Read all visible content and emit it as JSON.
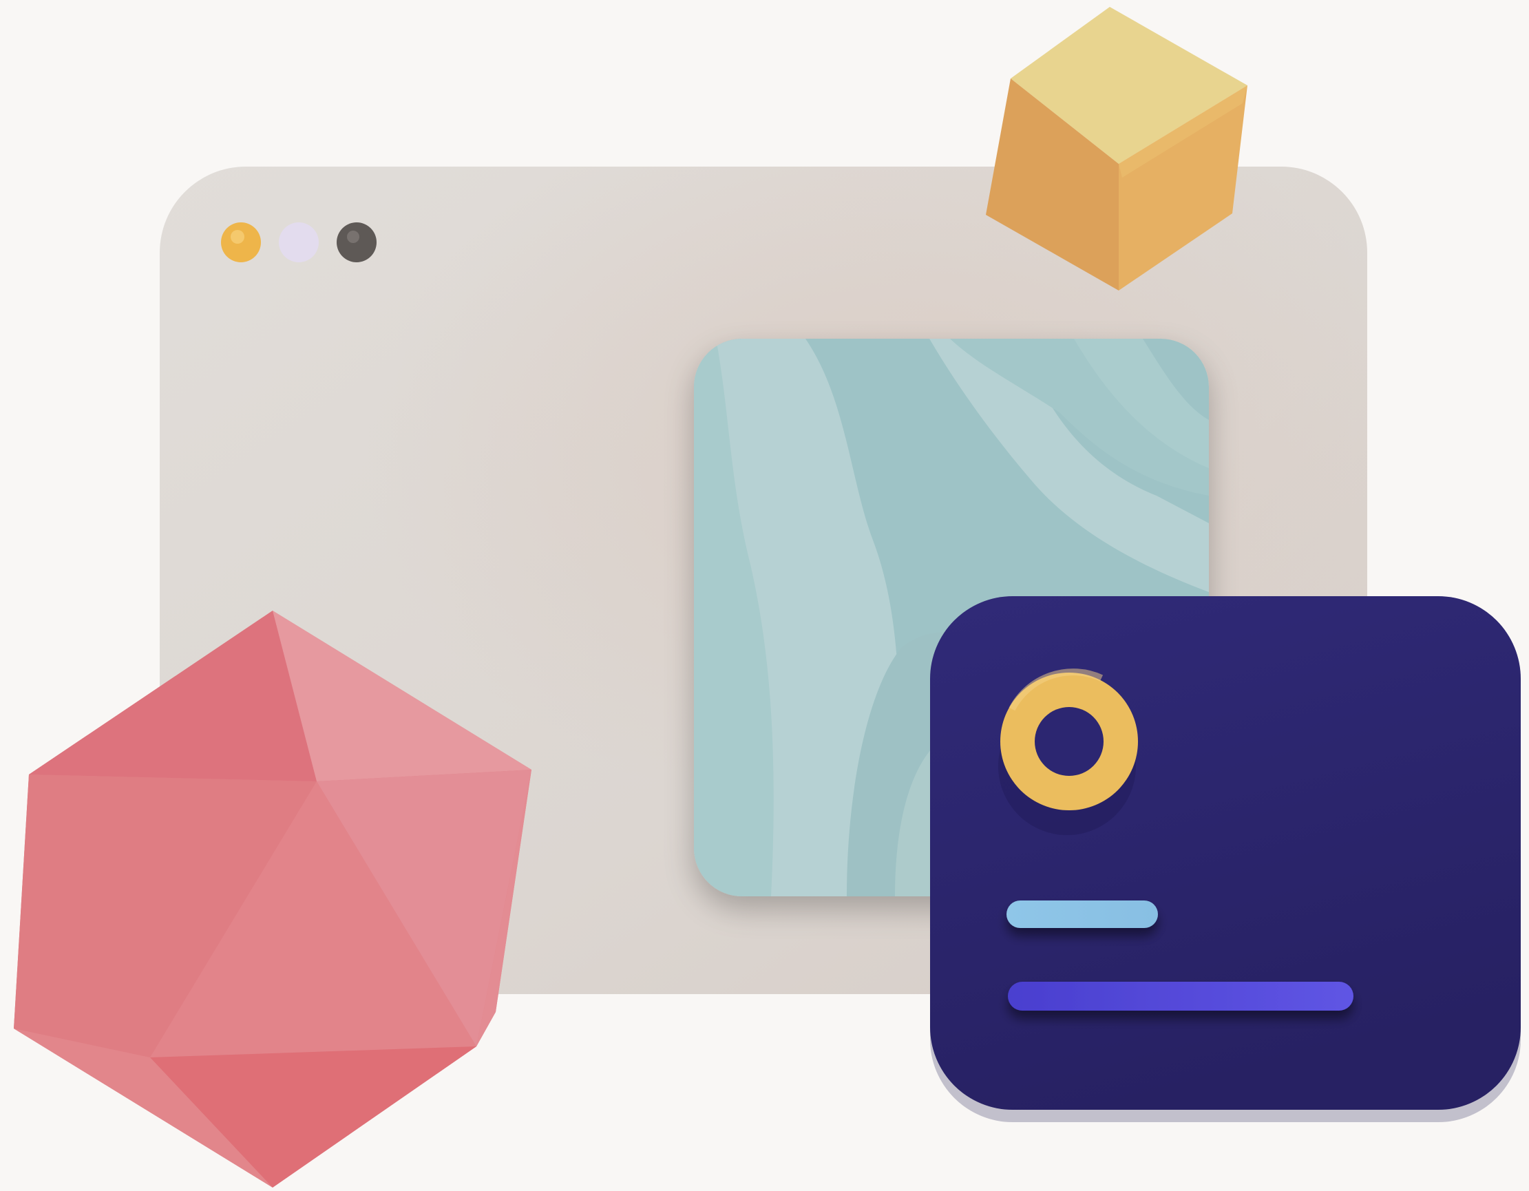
{
  "colors": {
    "background": "#f9f7f5",
    "browser_window": "#ddd8d4",
    "window_dot_yellow": "#eeb54a",
    "window_dot_lavender": "#e3dcee",
    "window_dot_gray": "#5e5956",
    "image_panel_teal": "#9fc7ca",
    "card_navy": "#2c2671",
    "ring_yellow": "#ebbd5e",
    "bar_light_blue": "#8ec5e6",
    "bar_indigo": "#5248d8",
    "cube_top": "#e8d48f",
    "cube_left": "#dca15a",
    "cube_right": "#e6b063",
    "icosahedron_pink": "#e07f86"
  },
  "elements": {
    "browser_window": "browser-window-illustration",
    "window_controls": [
      "yellow-dot",
      "lavender-dot",
      "gray-dot"
    ],
    "image_placeholder": "wavy-image-icon",
    "profile_card": "id-card-illustration",
    "avatar": "ring-avatar-icon",
    "text_lines": [
      "short-line",
      "long-line"
    ],
    "decorations": [
      "cube-icon",
      "icosahedron-icon"
    ]
  }
}
